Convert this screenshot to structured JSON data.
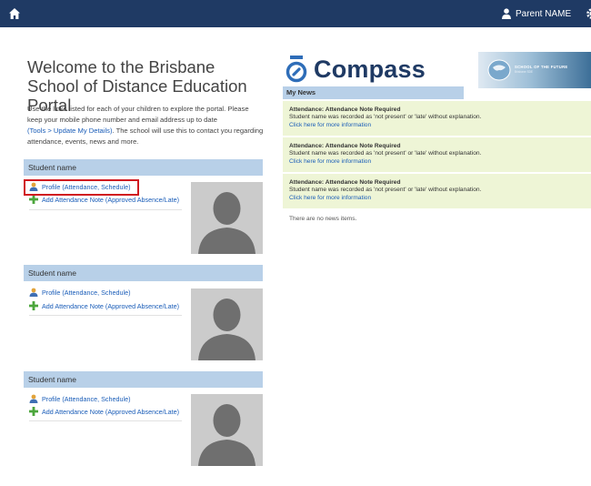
{
  "topbar": {
    "user_name": "Parent NAME"
  },
  "welcome": {
    "title": "Welcome to the Brisbane School of Distance Education Portal",
    "intro_1": "Use the links listed for each of your children to explore the portal. Please keep your mobile phone number and email address up to date",
    "intro_link": "(Tools > Update My Details)",
    "intro_2": ". The school will use this to contact you regarding attendance, events, news and more."
  },
  "students": [
    {
      "name": "Student name",
      "profile_link": "Profile (Attendance, Schedule)",
      "note_link": "Add Attendance Note (Approved Absence/Late)"
    },
    {
      "name": "Student name",
      "profile_link": "Profile (Attendance, Schedule)",
      "note_link": "Add Attendance Note (Approved Absence/Late)"
    },
    {
      "name": "Student name",
      "profile_link": "Profile (Attendance, Schedule)",
      "note_link": "Add Attendance Note (Approved Absence/Late)"
    }
  ],
  "compass": {
    "logo_text": "Compass"
  },
  "banner": {
    "text": "SCHOOL OF THE FUTURE",
    "subtext": "Brisbane SDE"
  },
  "news": {
    "header": "My News",
    "items": [
      {
        "title": "Attendance: Attendance Note Required",
        "body": "Student name was recorded as 'not present' or 'late' without explanation.",
        "link": "Click here for more information"
      },
      {
        "title": "Attendance: Attendance Note Required",
        "body": "Student name was recorded as 'not present' or 'late' without explanation.",
        "link": "Click here for more information"
      },
      {
        "title": "Attendance: Attendance Note Required",
        "body": "Student name was recorded as 'not present' or 'late' without explanation.",
        "link": "Click here for more information"
      }
    ],
    "empty_text": "There are no news items."
  },
  "colors": {
    "topbar": "#1f3a64",
    "section_header": "#b8d0e8",
    "news_bg": "#eef5d6",
    "link": "#1a5db8",
    "highlight": "#d01820"
  }
}
